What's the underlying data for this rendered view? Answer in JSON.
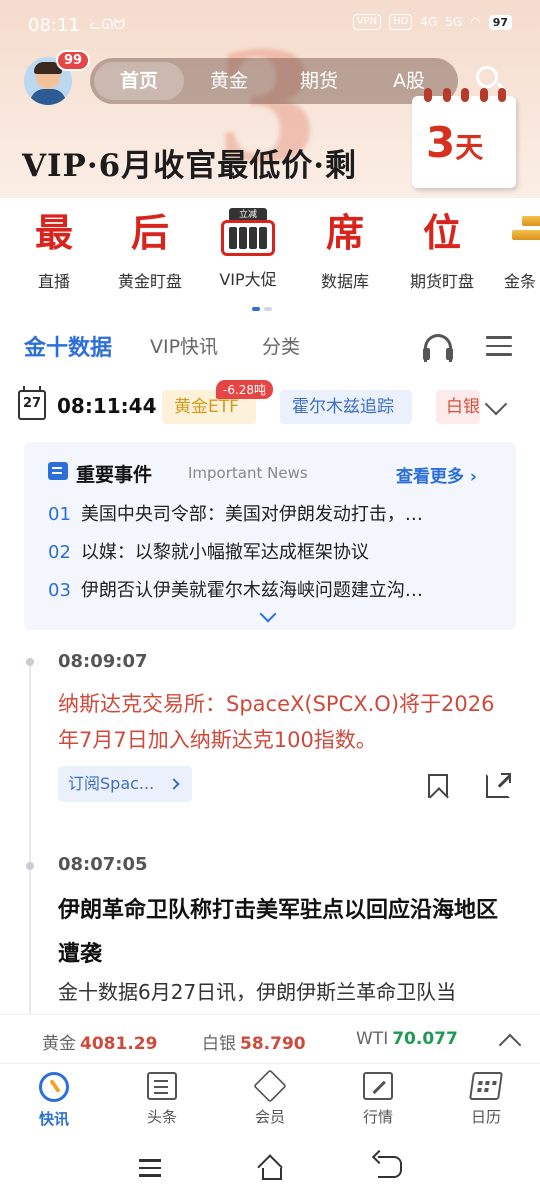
{
  "status_bar": {
    "time": "08:11",
    "vpn": "VPN",
    "hd": "HD",
    "net1": "4G",
    "net2": "5G",
    "battery": "97"
  },
  "header": {
    "badge": "99",
    "tabs": [
      "首页",
      "黄金",
      "期货",
      "A股"
    ],
    "active_tab": "首页",
    "banner_text": "VIP·6月收官最低价·剩",
    "banner_days": "3",
    "banner_days_unit": "天"
  },
  "shortcuts": [
    {
      "glyph": "最",
      "label": "直播"
    },
    {
      "glyph": "后",
      "label": "黄金盯盘"
    },
    {
      "glyph": "立减",
      "label": "VIP大促"
    },
    {
      "glyph": "席",
      "label": "数据库"
    },
    {
      "glyph": "位",
      "label": "期货盯盘"
    },
    {
      "glyph": "",
      "label": "金条"
    }
  ],
  "data_tabs": {
    "items": [
      "金十数据",
      "VIP快讯",
      "分类"
    ],
    "active": "金十数据"
  },
  "date_row": {
    "calendar_day": "27",
    "clock": "08:11:44",
    "chips": [
      "黄金ETF",
      "霍尔木兹追踪",
      "白银"
    ],
    "gold_badge": "-6.28吨"
  },
  "important_news": {
    "title": "重要事件",
    "subtitle": "Important News",
    "more": "查看更多",
    "items": [
      {
        "no": "01",
        "text": "美国中央司令部：美国对伊朗发动打击，…"
      },
      {
        "no": "02",
        "text": "以媒：以黎就小幅撤军达成框架协议"
      },
      {
        "no": "03",
        "text": "伊朗否认伊美就霍尔木兹海峡问题建立沟…"
      }
    ]
  },
  "feed": [
    {
      "time": "08:09:07",
      "text": "纳斯达克交易所：SpaceX(SPCX.O)将于2026年7月7日加入纳斯达克100指数。",
      "subscribe": "订阅Spac..."
    },
    {
      "time": "08:07:05",
      "headline": "伊朗革命卫队称打击美军驻点以回应沿海地区遭袭",
      "body": "金十数据6月27日讯，伊朗伊斯兰革命卫队当"
    }
  ],
  "ticker": [
    {
      "name": "黄金",
      "value": "4081.29",
      "color": "#d04a3c"
    },
    {
      "name": "白银",
      "value": "58.790",
      "color": "#d04a3c"
    },
    {
      "name": "WTI",
      "value": "70.077",
      "color": "#1f9a55"
    }
  ],
  "bottom_nav": [
    {
      "label": "快讯",
      "icon": "flash-icon"
    },
    {
      "label": "头条",
      "icon": "news-icon"
    },
    {
      "label": "会员",
      "icon": "diamond-icon"
    },
    {
      "label": "行情",
      "icon": "trend-icon"
    },
    {
      "label": "日历",
      "icon": "calendar-icon"
    }
  ],
  "colors": {
    "accent": "#2d6fd9",
    "brand_red": "#d8241c",
    "up": "#d04a3c",
    "down": "#1f9a55"
  }
}
